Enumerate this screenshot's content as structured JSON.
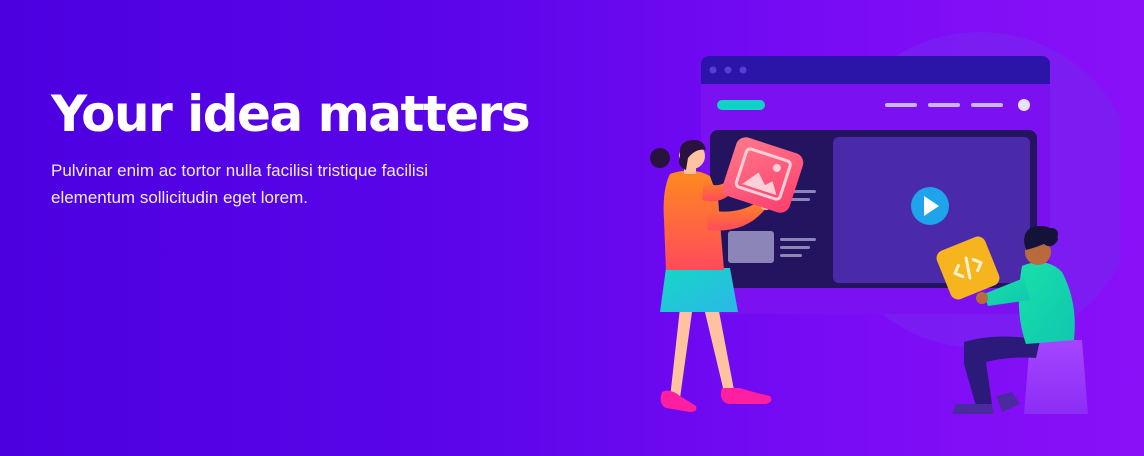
{
  "hero": {
    "title": "Your idea matters",
    "description": "Pulvinar enim ac tortor nulla facilisi tristique facilisi elementum sollicitudin eget lorem."
  },
  "illustration": {
    "icons": [
      "play-icon",
      "image-icon",
      "code-icon"
    ],
    "colors": {
      "browser_frame": "#2b14a8",
      "browser_body": "#7b10f0",
      "screen": "#241460",
      "video_panel": "#4a2aa8",
      "play_button": "#1fa3ea",
      "image_card": "#ff5c7a",
      "code_card": "#f6b51e",
      "accent_pill": "#12d1c6"
    }
  }
}
